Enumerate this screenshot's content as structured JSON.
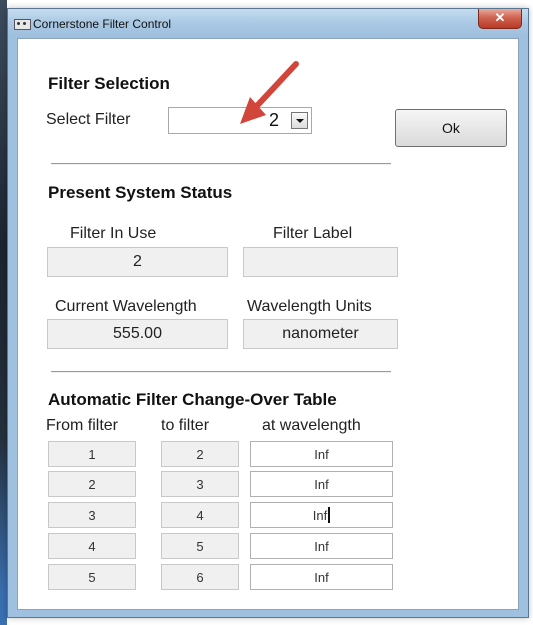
{
  "window": {
    "title": "Cornerstone  Filter Control",
    "close_glyph": "✕"
  },
  "filter_selection": {
    "heading": "Filter Selection",
    "select_label": "Select Filter",
    "selected_value": "2",
    "ok_label": "Ok"
  },
  "status": {
    "heading": "Present System Status",
    "filter_in_use_label": "Filter In Use",
    "filter_in_use_value": "2",
    "filter_label_label": "Filter Label",
    "filter_label_value": "",
    "current_wavelength_label": "Current Wavelength",
    "current_wavelength_value": "555.00",
    "wavelength_units_label": "Wavelength Units",
    "wavelength_units_value": "nanometer"
  },
  "changeover": {
    "heading": "Automatic Filter Change-Over Table",
    "col_from": "From filter",
    "col_to": "to filter",
    "col_wavelength": "at wavelength",
    "rows": [
      {
        "from": "1",
        "to": "2",
        "wavelength": "Inf"
      },
      {
        "from": "2",
        "to": "3",
        "wavelength": "Inf"
      },
      {
        "from": "3",
        "to": "4",
        "wavelength": "Inf"
      },
      {
        "from": "4",
        "to": "5",
        "wavelength": "Inf"
      },
      {
        "from": "5",
        "to": "6",
        "wavelength": "Inf"
      }
    ]
  },
  "annotation": {
    "arrow_color": "#d2453a"
  },
  "icons": {
    "app": "app-icon",
    "close": "close-icon",
    "dropdown": "chevron-down-icon"
  }
}
